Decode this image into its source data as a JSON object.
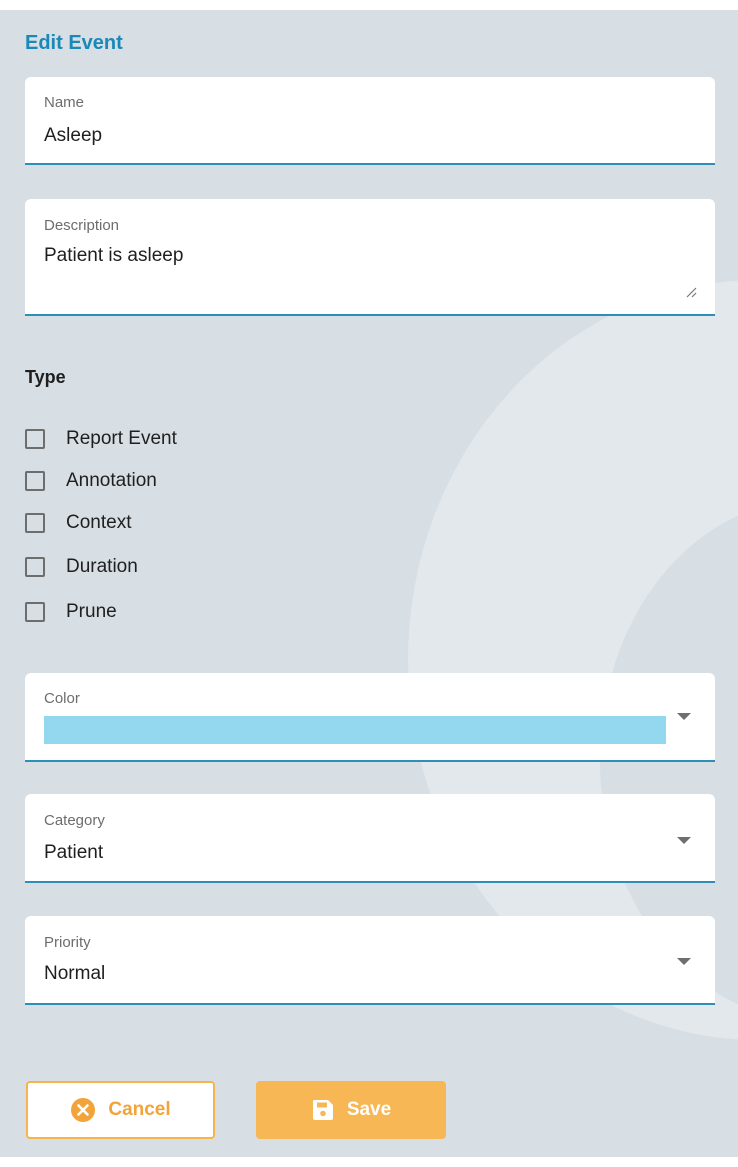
{
  "form": {
    "title": "Edit Event"
  },
  "name": {
    "label": "Name",
    "value": "Asleep"
  },
  "description": {
    "label": "Description",
    "value": "Patient is asleep"
  },
  "type": {
    "heading": "Type",
    "options": [
      {
        "label": "Report Event",
        "checked": false
      },
      {
        "label": "Annotation",
        "checked": false
      },
      {
        "label": "Context",
        "checked": false
      },
      {
        "label": "Duration",
        "checked": false
      },
      {
        "label": "Prune",
        "checked": false
      }
    ]
  },
  "color": {
    "label": "Color",
    "value": "#93d8ef"
  },
  "category": {
    "label": "Category",
    "value": "Patient"
  },
  "priority": {
    "label": "Priority",
    "value": "Normal"
  },
  "actions": {
    "cancel_label": "Cancel",
    "save_label": "Save"
  },
  "theme": {
    "accent": "#1b88b8",
    "button": "#f8b755",
    "background": "#d7dee4"
  },
  "icons": {
    "cancel": "x-circle-icon",
    "save": "floppy-disk-icon",
    "dropdown": "caret-down-icon",
    "resize": "resize-handle-icon"
  }
}
